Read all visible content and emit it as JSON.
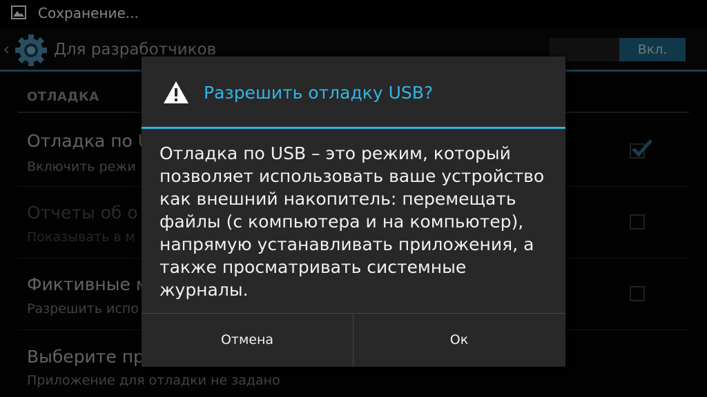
{
  "status_bar": {
    "icon": "image-icon",
    "text": "Сохранение..."
  },
  "action_bar": {
    "back_icon": "chevron-left-icon",
    "app_icon": "gear-icon",
    "title": "Для разработчиков",
    "switch_label": "Вкл."
  },
  "settings": {
    "section_header": "ОТЛАДКА",
    "items": [
      {
        "title": "Отладка по U",
        "summary": "Включить режи",
        "checked": true,
        "enabled": true
      },
      {
        "title": "Отчеты об о",
        "summary": "Показывать в м",
        "checked": false,
        "enabled": false
      },
      {
        "title": "Фиктивные м",
        "summary": "Разрешить испо",
        "checked": false,
        "enabled": true
      },
      {
        "title": "Выберите пр",
        "summary": "Приложение для отладки не задано",
        "enabled": true
      }
    ]
  },
  "dialog": {
    "icon": "warning-icon",
    "title": "Разрешить отладку USB?",
    "message": "Отладка по USB – это режим, который позволяет использовать ваше устройство как внешний накопитель: перемещать файлы (с компьютера и на компьютер), напрямую устанавливать приложения, а также просматривать системные журналы.",
    "cancel_label": "Отмена",
    "ok_label": "Ок"
  },
  "colors": {
    "accent": "#33b5e5",
    "switch_on": "#1f6787"
  }
}
